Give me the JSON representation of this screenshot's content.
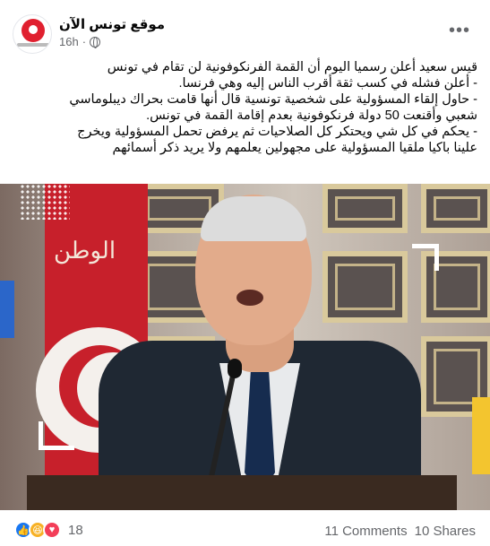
{
  "post": {
    "page_name": "موقع تونس الآن",
    "time": "16h",
    "audience_icon": "globe-icon",
    "more_icon": "more-options-icon",
    "lines": [
      "قيس سعيد أعلن رسميا اليوم أن القمة الفرنكوفونية لن تقام في تونس",
      "- أعلن فشله في كسب ثقة أقرب الناس إليه وهي فرنسا.",
      "- حاول إلقاء المسؤولية على شخصية تونسية قال أنها قامت بحراك ديبلوماسي",
      "شعبي وأقنعت 50 دولة فرنكوفونية بعدم  إقامة القمة في تونس.",
      "- يحكم في كل شي ويحتكر كل الصلاحيات ثم يرفض تحمل المسؤولية ويخرج",
      "علينا باكيا ملقيا المسؤولية على مجهولين يعلمهم ولا يريد ذكر أسمائهم"
    ],
    "flag_text": "الوطن"
  },
  "footer": {
    "reactions": [
      "like-icon",
      "haha-icon",
      "love-icon"
    ],
    "reaction_count": "18",
    "comments": "11 Comments",
    "shares": "10 Shares"
  },
  "colors": {
    "accent": "#1877f2",
    "love": "#f33e58",
    "haha": "#f7b125",
    "brand_red": "#e0202f"
  }
}
